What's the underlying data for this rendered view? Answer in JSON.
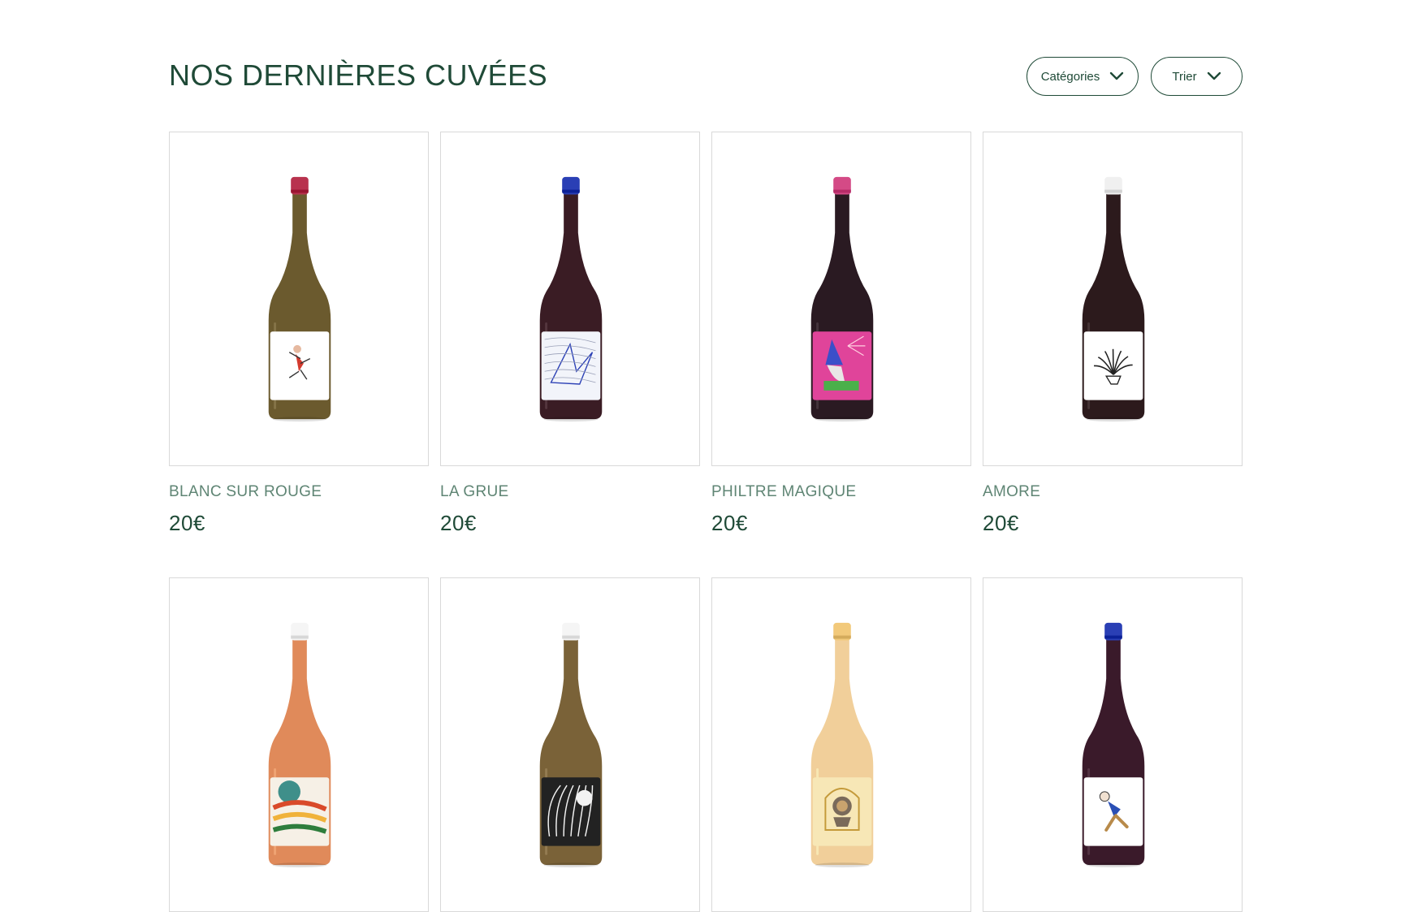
{
  "header": {
    "title": "NOS DERNIÈRES CUVÉES",
    "filters": {
      "categories_label": "Catégories",
      "sort_label": "Trier"
    }
  },
  "products": [
    {
      "name": "BLANC SUR ROUGE",
      "price": "20€",
      "glass": "#6b5a2e",
      "cap": "#b8324e",
      "label_bg": "#ffffff",
      "label_art": "dancer"
    },
    {
      "name": "LA GRUE",
      "price": "20€",
      "glass": "#3a1c24",
      "cap": "#2a3fb5",
      "label_bg": "#f2f4fa",
      "label_art": "crane"
    },
    {
      "name": "PHILTRE MAGIQUE",
      "price": "20€",
      "glass": "#2a1a22",
      "cap": "#d44a86",
      "label_bg": "#e0449a",
      "label_art": "wizard"
    },
    {
      "name": "AMORE",
      "price": "20€",
      "glass": "#2c1a1c",
      "cap": "#f0f0f0",
      "label_bg": "#ffffff",
      "label_art": "plant"
    },
    {
      "name": "",
      "price": "",
      "glass": "#e08a5a",
      "cap": "#f5f5f5",
      "label_bg": "#f6f0e6",
      "label_art": "pattern"
    },
    {
      "name": "",
      "price": "",
      "glass": "#7a6238",
      "cap": "#f5f5f5",
      "label_bg": "#222222",
      "label_art": "leaves"
    },
    {
      "name": "",
      "price": "",
      "glass": "#f1cf9a",
      "cap": "#f2c97a",
      "label_bg": "#f7e7b6",
      "label_art": "lion"
    },
    {
      "name": "",
      "price": "",
      "glass": "#3a1a2a",
      "cap": "#2a3fb5",
      "label_bg": "#ffffff",
      "label_art": "runner"
    }
  ]
}
